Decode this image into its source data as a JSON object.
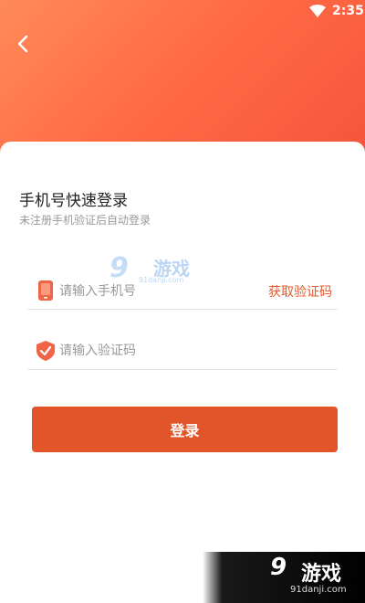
{
  "status_bar": {
    "time": "2:35"
  },
  "login": {
    "title": "手机号快速登录",
    "subtitle": "未注册手机验证后自动登录",
    "phone_placeholder": "请输入手机号",
    "get_code_label": "获取验证码",
    "code_placeholder": "请输入验证码",
    "login_button_label": "登录"
  },
  "watermark": {
    "num": "9",
    "brand": "游戏",
    "site": "91danji.com"
  },
  "colors": {
    "accent": "#e2552a",
    "hero_start": "#ff8a5a",
    "hero_end": "#f4533c"
  }
}
